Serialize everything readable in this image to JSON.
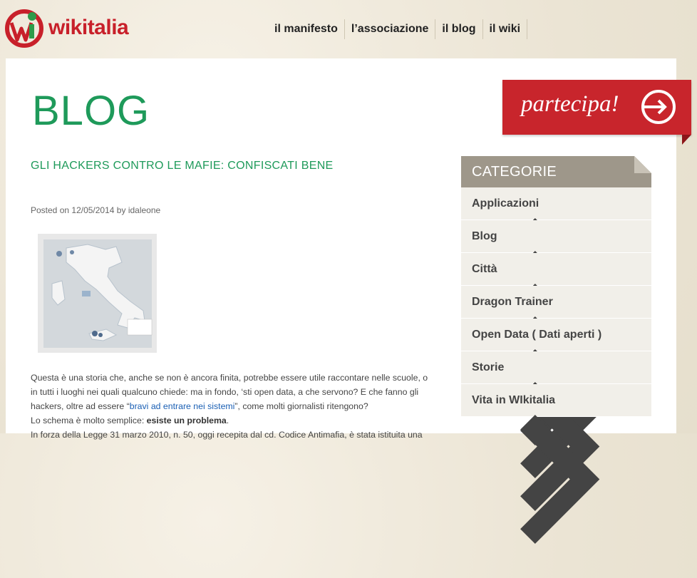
{
  "header": {
    "logo_text": "wikitalia",
    "nav": [
      "il manifesto",
      "l’associazione",
      "il blog",
      "il wiki"
    ]
  },
  "page": {
    "title": "BLOG",
    "partecipa_label": "partecipa!"
  },
  "post": {
    "title": "GLI HACKERS CONTRO LE MAFIE: CONFISCATI BENE",
    "meta_prefix": "Posted on",
    "date": "12/05/2014",
    "meta_by": "by",
    "author": "idaleone",
    "p1_a": "Questa è una storia che, anche se non è ancora finita, potrebbe essere utile raccontare nelle scuole, o in tutti i luoghi nei quali qualcuno chiede: ma in fondo, ‘sti open data, a che servono? E che fanno gli hackers, oltre ad essere “",
    "p1_link": "bravi ad entrare nei sistemi",
    "p1_b": "”, come molti giornalisti ritengono?",
    "p2_a": "Lo schema è molto semplice: ",
    "p2_bold": "esiste un problema",
    "p2_b": ".",
    "p3": "In forza della Legge 31 marzo 2010, n. 50, oggi recepita dal cd. Codice Antimafia, è stata istituita una"
  },
  "sidebar": {
    "heading": "CATEGORIE",
    "items": [
      "Applicazioni",
      "Blog",
      "Città",
      "Dragon Trainer",
      "Open Data ( Dati aperti )",
      "Storie",
      "Vita in WIkitalia"
    ]
  },
  "colors": {
    "brand_red": "#c8252c",
    "brand_green": "#1e9a5a",
    "sidebar_head": "#9e978a",
    "sidebar_item": "#f1efe9"
  }
}
